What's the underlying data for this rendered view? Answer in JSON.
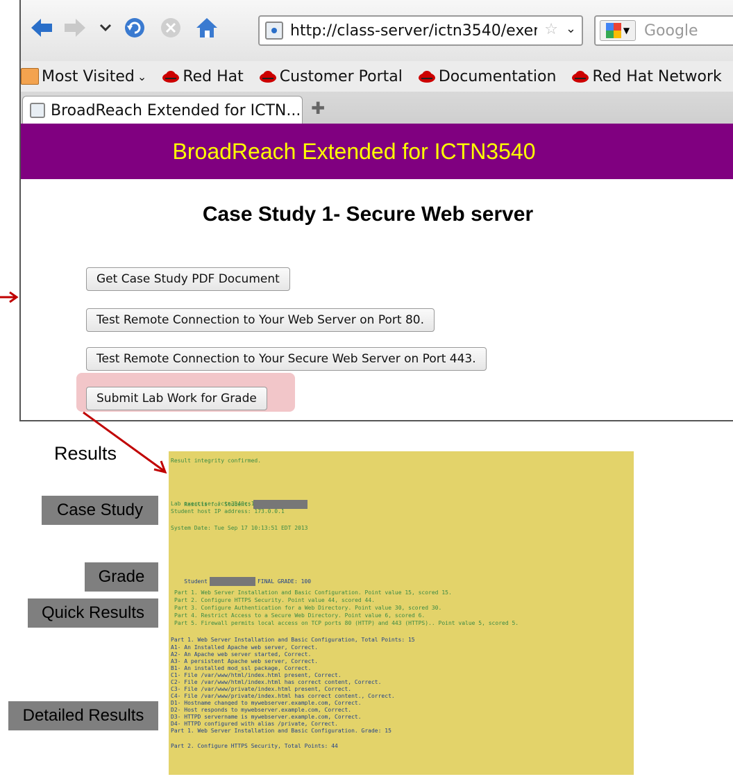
{
  "browser": {
    "url": "http://class-server/ictn3540/exerc",
    "search_placeholder": "Google",
    "bookmarks": [
      "Most Visited",
      "Red Hat",
      "Customer Portal",
      "Documentation",
      "Red Hat Network"
    ],
    "tab_title": "BroadReach Extended for ICTN...",
    "icons": [
      "back-arrow-icon",
      "forward-arrow-icon",
      "history-dropdown-icon",
      "reload-icon",
      "stop-icon",
      "home-icon",
      "bookmark-star-icon",
      "magnifier-icon",
      "redhat-icon",
      "new-tab-plus-icon"
    ]
  },
  "site": {
    "title": "BroadReach Extended for ICTN3540",
    "heading": "Case Study 1- Secure Web server",
    "colors": {
      "header_bg": "#800080",
      "header_text": "#ffff00"
    }
  },
  "buttons": [
    "Get Case Study PDF Document",
    "Test Remote Connection to Your Web Server on Port 80.",
    "Test Remote Connection to Your Secure Web Server on Port 443.",
    "Submit Lab Work for Grade"
  ],
  "annotations": {
    "results": "Results",
    "case_study": "Case Study",
    "grade": "Grade",
    "quick_results": "Quick Results",
    "detailed_results": "Detailed Results"
  },
  "results": {
    "integrity": "Result integrity confirmed.",
    "student_label": "Results for Student:",
    "lab_exercise": "Lab exercise: ictn3540cs1",
    "host_ip": "Student host IP address: 173.0.0.1",
    "system_date": "System Date: Tue Sep 17 10:13:51 EDT 2013",
    "grade_prefix": "Student",
    "grade_text": "FINAL GRADE: 100",
    "quick": [
      "Part 1. Web Server Installation and Basic Configuration. Point value 15, scored 15.",
      "Part 2. Configure HTTPS Security. Point value 44, scored 44.",
      "Part 3. Configure Authentication for a Web Directory. Point value 30, scored 30.",
      "Part 4. Restrict Access to a Secure Web Directory. Point value 6, scored 6.",
      "Part 5. Firewall permits local access on TCP ports 80 (HTTP) and 443 (HTTPS).. Point value 5, scored 5."
    ],
    "detailed": [
      "Part 1. Web Server Installation and Basic Configuration, Total Points: 15",
      "A1- An Installed Apache web server, Correct.",
      "A2- An Apache web server started, Correct.",
      "A3- A persistent Apache web server, Correct.",
      "B1- An installed mod_ssl package, Correct.",
      "C1- File /var/www/html/index.html present, Correct.",
      "C2- File /var/www/html/index.html has correct content, Correct.",
      "C3- File /var/www/private/index.html present, Correct.",
      "C4- File /var/www/private/index.html has correct content., Correct.",
      "D1- Hostname changed to mywebserver.example.com, Correct.",
      "D2- Host responds to mywebserver.example.com, Correct.",
      "D3- HTTPD servername is mywebserver.example.com, Correct.",
      "D4- HTTPD configured with alias /private, Correct.",
      "Part 1. Web Server Installation and Basic Configuration. Grade: 15"
    ],
    "part2_header": "Part 2. Configure HTTPS Security, Total Points: 44"
  }
}
